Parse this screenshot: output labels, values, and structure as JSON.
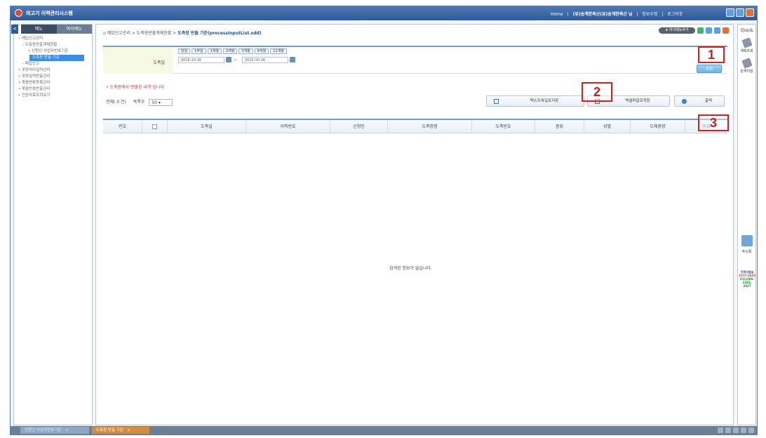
{
  "app": {
    "title": "의고기 이력관리시스템",
    "topnav": [
      "Home",
      "|",
      "(유)송계한축산(유)송계한축산 님",
      "|",
      "정보수정",
      "|",
      "로그아웃"
    ]
  },
  "sidebar": {
    "toggle": "<",
    "tabs": [
      "메뉴",
      "마이메뉴"
    ],
    "items": [
      {
        "label": "• 매입신고관리",
        "level": 1
      },
      {
        "label": "- 도축장반출계체현황",
        "level": 2
      },
      {
        "label": "• 신청인 사업자번호기준",
        "level": 3
      },
      {
        "label": "도축장 반출 기준",
        "level": 3,
        "selected": true
      },
      {
        "label": "- 매입신고",
        "level": 2
      },
      {
        "label": "• 포장처리실적관리",
        "level": 1
      },
      {
        "label": "• 포장실적반출관리",
        "level": 1
      },
      {
        "label": "• 묶음번호등록관리",
        "level": 1
      },
      {
        "label": "• 묶음번호반출관리",
        "level": 1
      },
      {
        "label": "• 전송자료조회보기",
        "level": 1
      }
    ]
  },
  "breadcrumb": {
    "home_icon": "home-icon",
    "path": "매입신고관리 > 도축장반출계체현황 >",
    "current": "도축장 반출 기준(processInputList.xdd)"
  },
  "header_right": {
    "myfav": "★ 마이메뉴추가"
  },
  "search": {
    "label": "도축일",
    "periods": [
      "당일",
      "1주일",
      "1개월",
      "2개월",
      "3개월",
      "6개월",
      "12개월"
    ],
    "date_from": "2015-10-16",
    "date_to": "2015-10-16",
    "tilde": "~",
    "button": "조회"
  },
  "notice": "• 도축장에서 반출된 내역 입니다",
  "list": {
    "total": "전체( 0 건)",
    "rows_label": "목록수",
    "rows_value": "50 ▾"
  },
  "actions": {
    "text_save": "텍스트파일로저장",
    "excel_save": "엑셀파일로저장",
    "print": "출력"
  },
  "table": {
    "headers": [
      "번호",
      "",
      "도축일",
      "이력번호",
      "신청인",
      "도축장명",
      "도축번호",
      "종류",
      "성별",
      "도체중량",
      "등급"
    ]
  },
  "empty_message": "검색된 정보가 없습니다.",
  "markers": [
    "1",
    "2",
    "3"
  ],
  "quick": {
    "title": "Quick",
    "items": [
      {
        "label": "계획조회",
        "icon": "pen-icon"
      },
      {
        "label": "원격지원",
        "icon": "tool-icon"
      }
    ],
    "address": "주소록",
    "help_title": "이력지원실",
    "help_phone1": "1577-2633",
    "help_phone2": "031)380-",
    "help_phone3": "3303, 3027"
  },
  "bottom_tabs": [
    {
      "label": "신청인 사업자번호기준",
      "close": "x"
    },
    {
      "label": "도축장 반출 기준",
      "close": "x"
    }
  ],
  "colors": {
    "titlebar": "#2d5a98",
    "accent": "#3a8ee6",
    "marker": "#d42020",
    "notice": "#d23a3a"
  }
}
